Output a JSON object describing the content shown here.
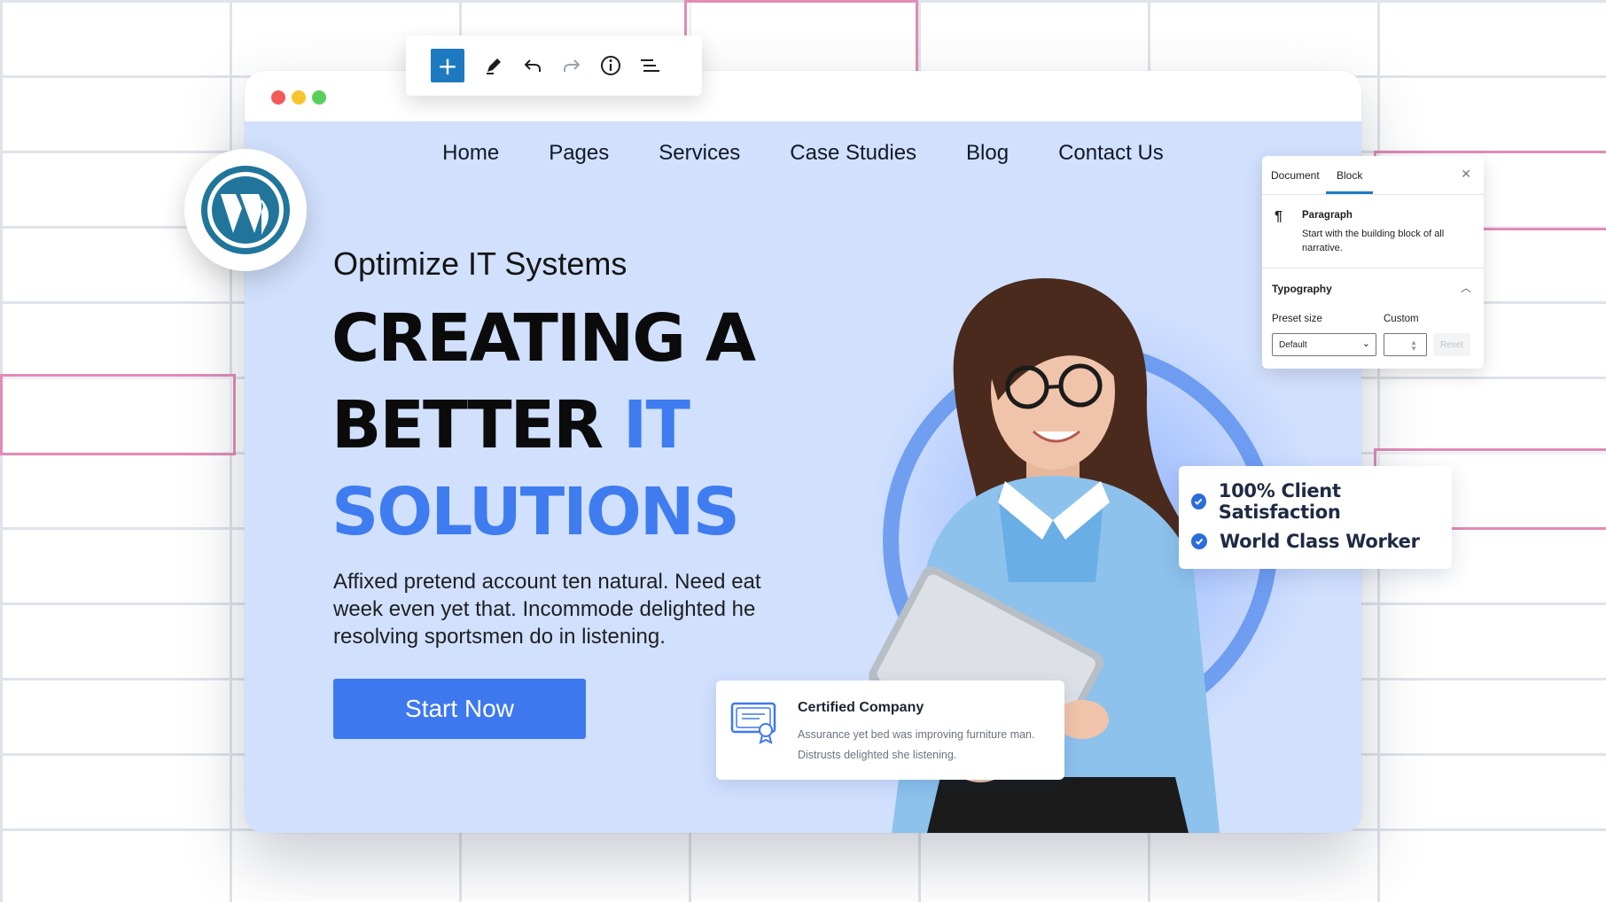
{
  "nav": {
    "items": [
      "Home",
      "Pages",
      "Services",
      "Case Studies",
      "Blog",
      "Contact Us"
    ]
  },
  "hero": {
    "eyebrow": "Optimize IT Systems",
    "headline_line1": "CREATING A",
    "headline_line2_dark": "BETTER ",
    "headline_line2_blue": "IT",
    "headline_line3": "SOLUTIONS",
    "description": "Affixed pretend account ten natural. Need eat week even yet that. Incommode delighted he resolving sportsmen do in listening.",
    "cta_label": "Start Now"
  },
  "certified": {
    "title": "Certified Company",
    "text": "Assurance yet bed was improving furniture man. Distrusts delighted she listening."
  },
  "features": [
    "100% Client Satisfaction",
    "World Class Worker"
  ],
  "panel": {
    "tabs": [
      "Document",
      "Block"
    ],
    "active_tab": "Block",
    "block_name": "Paragraph",
    "block_description": "Start with the building block of all narrative.",
    "section_title": "Typography",
    "preset_label": "Preset size",
    "custom_label": "Custom",
    "preset_value": "Default",
    "reset_label": "Reset"
  },
  "toolbar": {
    "add_icon": "plus-icon",
    "icons": [
      "pencil-icon",
      "undo-icon",
      "redo-icon",
      "info-icon",
      "list-view-icon"
    ]
  },
  "colors": {
    "accent": "#3e78ef",
    "site_bg": "#d1e0fd",
    "wp_blue": "#21759b",
    "toolbar_blue": "#1e7ac0"
  }
}
